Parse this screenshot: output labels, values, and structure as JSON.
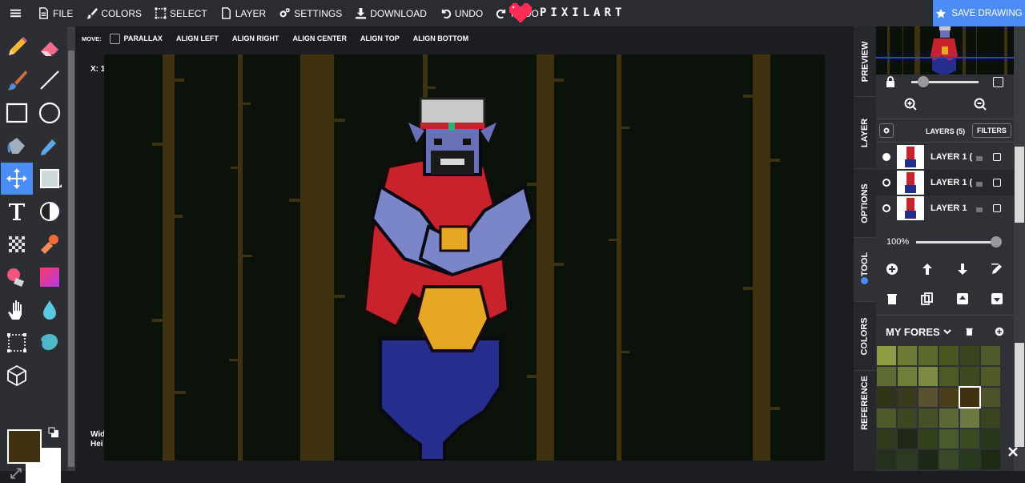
{
  "topbar": {
    "menu_icon": "hamburger-icon",
    "file": "FILE",
    "colors": "COLORS",
    "select": "SELECT",
    "layer": "LAYER",
    "settings": "SETTINGS",
    "download": "DOWNLOAD",
    "undo": "UNDO",
    "redo": "REDO",
    "brand": "PIXILART",
    "save": "SAVE DRAWING"
  },
  "options": {
    "move_label": "MOVE:",
    "parallax": "PARALLAX",
    "align_left": "ALIGN LEFT",
    "align_right": "ALIGN RIGHT",
    "align_center": "ALIGN CENTER",
    "align_top": "ALIGN TOP",
    "align_bottom": "ALIGN BOTTOM"
  },
  "canvas": {
    "x_readout": "X: 1",
    "width_label": "Wid",
    "height_label": "Hei"
  },
  "colors": {
    "primary": "#3f3211",
    "secondary": "#ffffff",
    "accent": "#4c8cf5",
    "background": "#0b1209"
  },
  "sidetabs": {
    "preview": "PREVIEW",
    "layer": "LAYER",
    "options": "OPTIONS",
    "tool": "TOOL",
    "colors": "COLORS",
    "reference": "REFERENCE"
  },
  "layers": {
    "header": "LAYERS (5)",
    "filters": "FILTERS",
    "opacity": "100%",
    "items": [
      {
        "name": "LAYER 1 (",
        "selected": true
      },
      {
        "name": "LAYER 1 (",
        "selected": false
      },
      {
        "name": "LAYER 1",
        "selected": false
      }
    ]
  },
  "palette": {
    "name": "MY FORES",
    "swatches": [
      "#8f9a45",
      "#6d7a35",
      "#5c6a2c",
      "#4a5624",
      "#3a4420",
      "#4f5a2a",
      "#5b6b32",
      "#6f7f3a",
      "#7c8a42",
      "#4e5a26",
      "#3f4a1e",
      "#505a28",
      "#2f3318",
      "#3a3a1c",
      "#5a5030",
      "#4a3e18",
      "#3f3211",
      "#4e5228",
      "#4c5a2a",
      "#3c4822",
      "#465028",
      "#5a6a36",
      "#6c7a40",
      "#3a4420",
      "#2e3a1a",
      "#1e2812",
      "#33401c",
      "#4a5a2c",
      "#3c4a22",
      "#2a361a",
      "#24301a",
      "#2c3a20",
      "#1c2814",
      "#3a4a28",
      "#2a3a1e",
      "#1e2a14"
    ]
  },
  "tools": [
    "pencil-icon",
    "eraser-icon",
    "brush-icon",
    "line-icon",
    "rectangle-icon",
    "circle-icon",
    "fill-bucket-icon",
    "eyedropper-icon",
    "move-icon",
    "selection-shape-icon",
    "text-icon",
    "dither-icon",
    "checker-icon",
    "stamp-icon",
    "color-eraser-icon",
    "gradient-icon",
    "hand-icon",
    "blur-drop-icon",
    "select-rect-icon",
    "lasso-icon",
    "3d-cube-icon"
  ]
}
